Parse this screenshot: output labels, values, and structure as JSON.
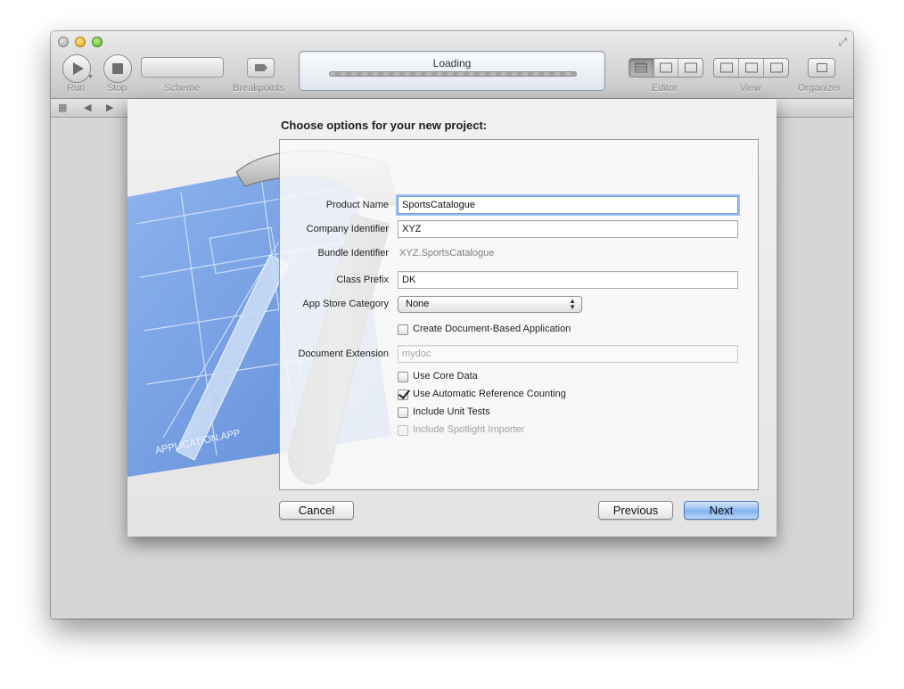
{
  "toolbar": {
    "run_label": "Run",
    "stop_label": "Stop",
    "scheme_label": "Scheme",
    "breakpoints_label": "Breakpoints",
    "activity_text": "Loading",
    "editor_label": "Editor",
    "view_label": "View",
    "organizer_label": "Organizer"
  },
  "sheet": {
    "heading": "Choose options for your new project:",
    "product_name": {
      "label": "Product Name",
      "value": "SportsCatalogue"
    },
    "company_identifier": {
      "label": "Company Identifier",
      "value": "XYZ"
    },
    "bundle_identifier": {
      "label": "Bundle Identifier",
      "value": "XYZ.SportsCatalogue"
    },
    "class_prefix": {
      "label": "Class Prefix",
      "value": "DK"
    },
    "app_store_category": {
      "label": "App Store Category",
      "value": "None"
    },
    "document_based": {
      "label": "Create Document-Based Application",
      "checked": false
    },
    "document_extension": {
      "label": "Document Extension",
      "placeholder": "mydoc"
    },
    "options": [
      {
        "label": "Use Core Data",
        "checked": false,
        "enabled": true
      },
      {
        "label": "Use Automatic Reference Counting",
        "checked": true,
        "enabled": true
      },
      {
        "label": "Include Unit Tests",
        "checked": false,
        "enabled": true
      },
      {
        "label": "Include Spotlight Importer",
        "checked": false,
        "enabled": false
      }
    ],
    "art_text": "APPLICATION.APP",
    "buttons": {
      "cancel": "Cancel",
      "previous": "Previous",
      "next": "Next"
    }
  },
  "colors": {
    "blueprint": "#7fa7e6",
    "default_button": "#8fbaf1",
    "focus_ring": "#9cc0f0"
  }
}
